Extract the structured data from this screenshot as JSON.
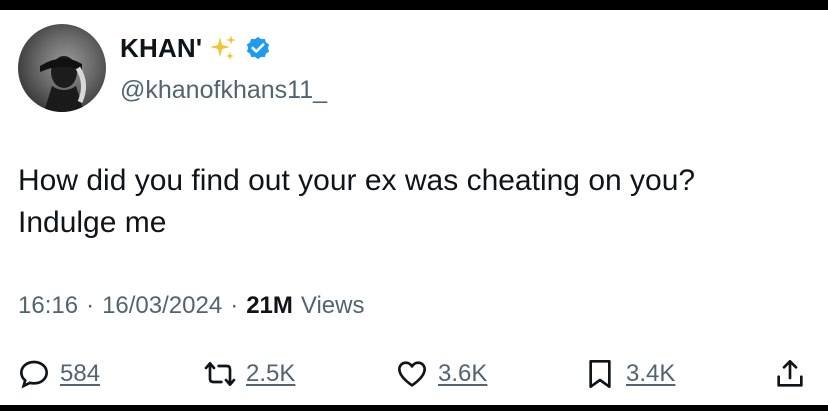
{
  "author": {
    "display_name": "KHAN'",
    "handle": "@khanofkhans11_"
  },
  "tweet": {
    "lines": [
      "How did you find out your ex was cheating on you?",
      "Indulge me"
    ]
  },
  "meta": {
    "time": "16:16",
    "separator": "·",
    "date": "16/03/2024",
    "views_count": "21M",
    "views_label": "Views"
  },
  "actions": {
    "replies": "584",
    "reposts": "2.5K",
    "likes": "3.6K",
    "bookmarks": "3.4K"
  },
  "colors": {
    "verified_badge": "#1d9bf0",
    "sparkle": "#f4c430",
    "secondary_text": "#536471",
    "primary_text": "#0f1419"
  },
  "icons": {
    "reply": "comment-bubble-icon",
    "repost": "repost-arrows-icon",
    "like": "heart-icon",
    "bookmark": "bookmark-icon",
    "share": "share-upload-icon",
    "verified": "verified-badge-icon",
    "sparkle": "sparkles-icon"
  }
}
